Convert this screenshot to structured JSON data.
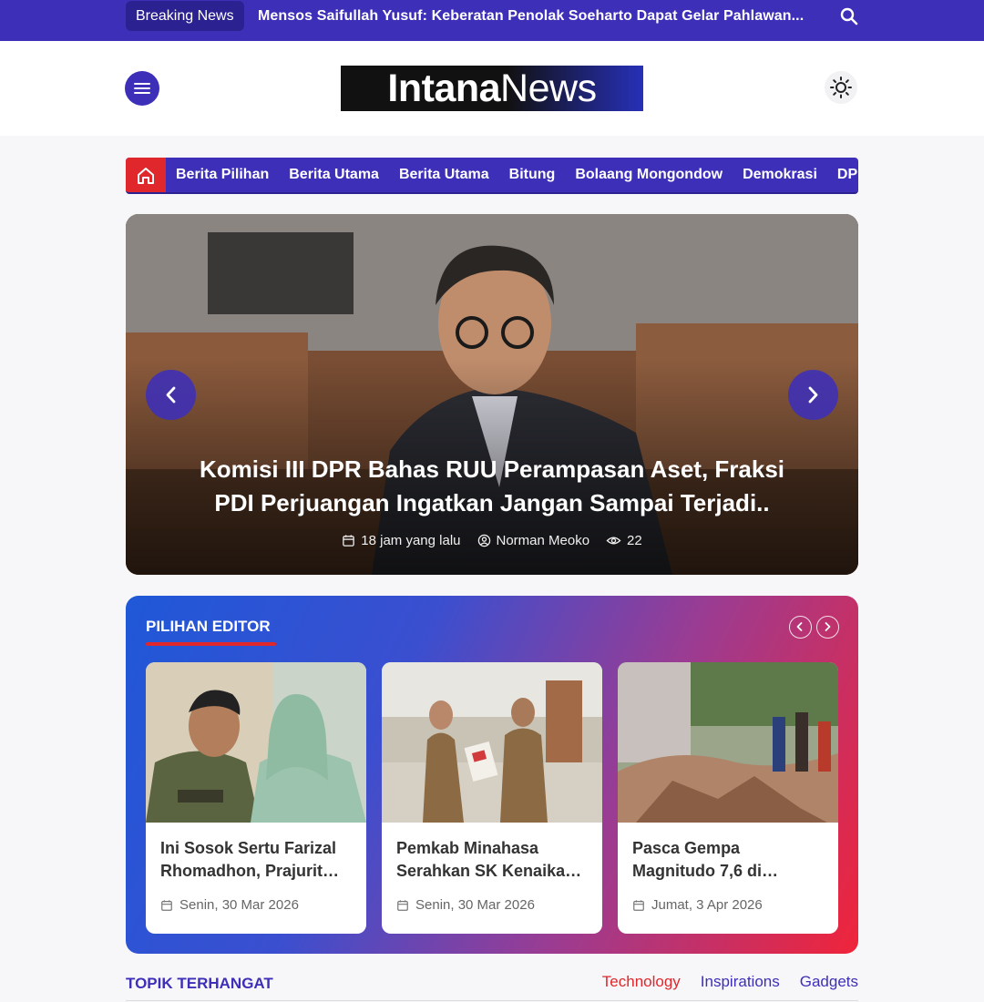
{
  "breaking": {
    "label": "Breaking News",
    "headline": "Mensos Saifullah Yusuf: Keberatan Penolak Soeharto Dapat Gelar Pahlawan..."
  },
  "header": {
    "logo_part1": "Intana",
    "logo_part2": "News"
  },
  "nav": {
    "items": [
      "Berita Pilihan",
      "Berita Utama",
      "Berita Utama",
      "Bitung",
      "Bolaang Mongondow",
      "Demokrasi",
      "DPRD"
    ]
  },
  "hero": {
    "title": "Komisi III DPR Bahas RUU Perampasan Aset, Fraksi PDI Perjuangan Ingatkan Jangan Sampai Terjadi..",
    "time": "18 jam yang lalu",
    "author": "Norman Meoko",
    "views": "22"
  },
  "editor": {
    "title": "PILIHAN EDITOR",
    "cards": [
      {
        "title": "Ini Sosok Sertu Farizal Rhomadhon, Prajurit…",
        "date": "Senin, 30 Mar 2026"
      },
      {
        "title": "Pemkab Minahasa Serahkan SK Kenaika…",
        "date": "Senin, 30 Mar 2026"
      },
      {
        "title": "Pasca Gempa Magnitudo 7,6 di…",
        "date": "Jumat, 3 Apr 2026"
      }
    ]
  },
  "topik": {
    "title": "TOPIK TERHANGAT",
    "tabs": [
      "Technology",
      "Inspirations",
      "Gadgets"
    ]
  },
  "colors": {
    "primary": "#3e2fb8",
    "accent": "#e0272b"
  }
}
